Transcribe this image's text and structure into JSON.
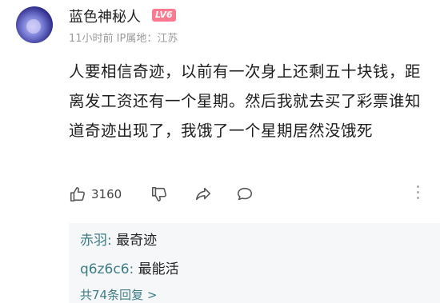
{
  "user": {
    "name": "蓝色神秘人",
    "level": "LV6",
    "meta": "11小时前 IP属地：江苏"
  },
  "comment": {
    "text": "人要相信奇迹，以前有一次身上还剩五十块钱，距离发工资还有一个星期。然后我就去买了彩票谁知道奇迹出现了，我饿了一个星期居然没饿死"
  },
  "actions": {
    "like_count": "3160",
    "icons": [
      "thumb-up-icon",
      "thumb-down-icon",
      "share-icon",
      "reply-bubble-icon",
      "more-vertical-icon"
    ]
  },
  "replies": {
    "items": [
      {
        "author": "赤羽",
        "sep": ": ",
        "text": "最奇迹"
      },
      {
        "author": "q6z6c6",
        "sep": ": ",
        "text": "最能活"
      }
    ],
    "more": "共74条回复 >"
  },
  "colors": {
    "reply_author": "#3d7d88",
    "badge": "#ff7a90",
    "meta": "#9a9a9a"
  }
}
